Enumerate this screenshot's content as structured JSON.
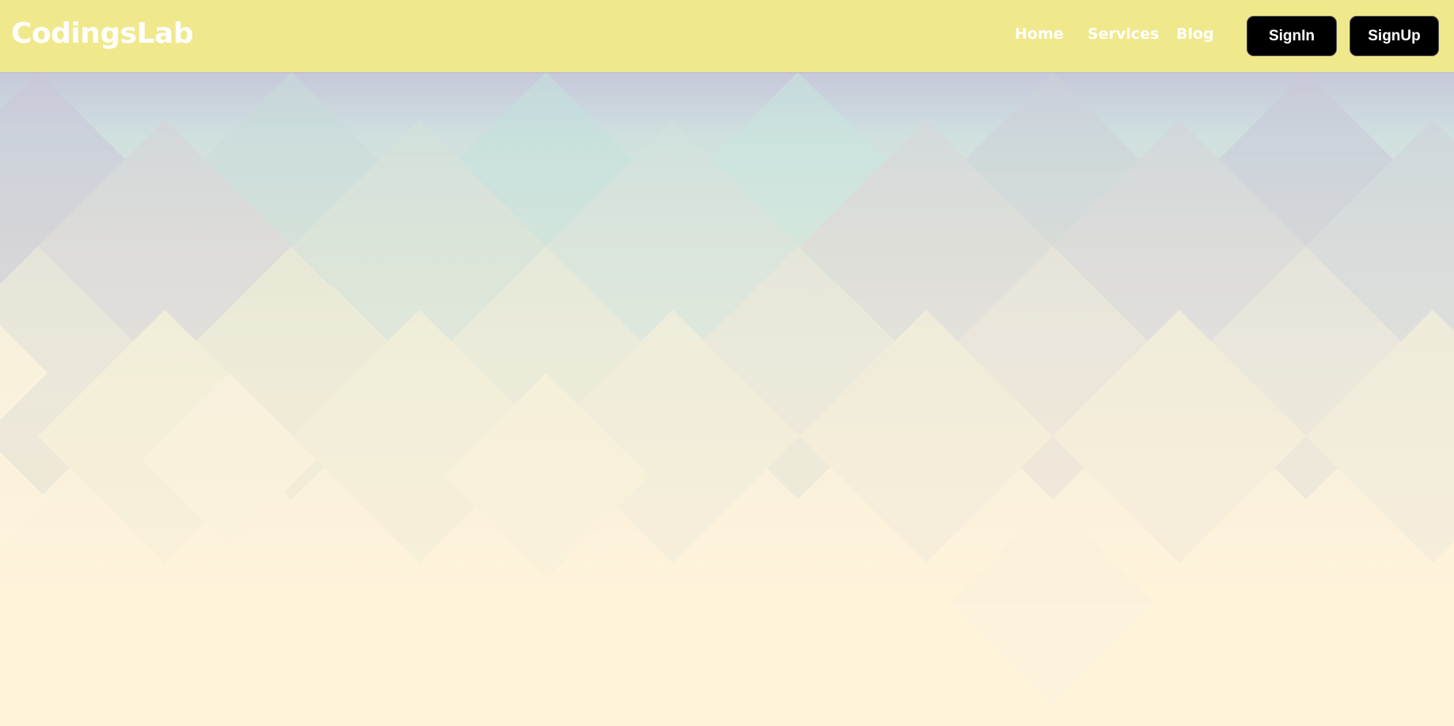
{
  "brand": {
    "name": "CodingsLab"
  },
  "nav": {
    "links": [
      {
        "label": "Home"
      },
      {
        "label": "Services"
      },
      {
        "label": "Blog"
      }
    ]
  },
  "auth": {
    "signin_label": "SignIn",
    "signup_label": "SignUp"
  },
  "colors": {
    "navbar": "#f0e88c",
    "nav_text": "#ffffff",
    "button_bg": "#000000",
    "button_text": "#ffffff",
    "page_bg": "#fff3da"
  }
}
